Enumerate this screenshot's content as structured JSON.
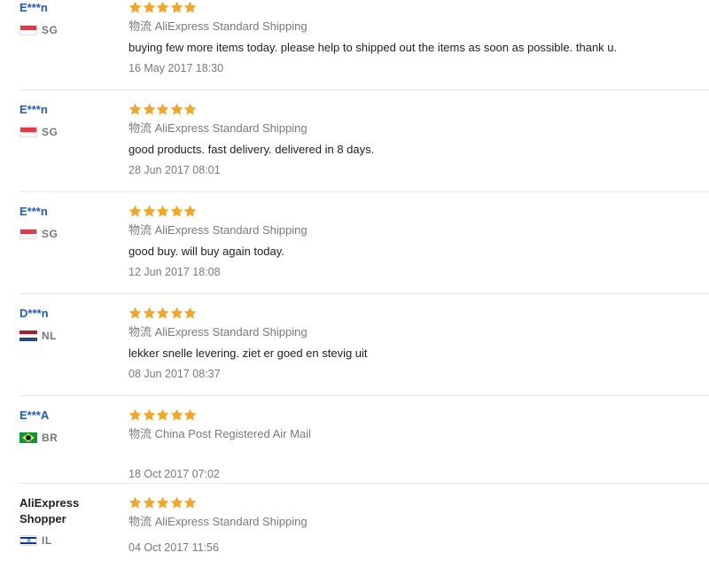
{
  "colors": {
    "star": "#f5a623",
    "buyer_link": "#1a5dc8",
    "meta_text": "#7a7a7a",
    "divider": "#e8e8e8"
  },
  "reviews": [
    {
      "buyer": "E***n",
      "country": "SG",
      "flag_icon": "singapore-flag-icon",
      "rating": 5,
      "shipping": "物流 AliExpress Standard Shipping",
      "feedback": "buying few more items today. please help to shipped out the items as soon as possible. thank u.",
      "date": "16 May 2017 18:30"
    },
    {
      "buyer": "E***n",
      "country": "SG",
      "flag_icon": "singapore-flag-icon",
      "rating": 5,
      "shipping": "物流 AliExpress Standard Shipping",
      "feedback": "good products. fast delivery. delivered in 8 days.",
      "date": "28 Jun 2017 08:01"
    },
    {
      "buyer": "E***n",
      "country": "SG",
      "flag_icon": "singapore-flag-icon",
      "rating": 5,
      "shipping": "物流 AliExpress Standard Shipping",
      "feedback": "good buy. will buy again today.",
      "date": "12 Jun 2017 18:08"
    },
    {
      "buyer": "D***n",
      "country": "NL",
      "flag_icon": "netherlands-flag-icon",
      "rating": 5,
      "shipping": "物流 AliExpress Standard Shipping",
      "feedback": "lekker snelle levering. ziet er goed en stevig uit",
      "date": "08 Jun 2017 08:37"
    },
    {
      "buyer": "E***A",
      "country": "BR",
      "flag_icon": "brazil-flag-icon",
      "rating": 5,
      "shipping": "物流 China Post Registered Air Mail",
      "feedback": "",
      "date": "18 Oct 2017 07:02"
    },
    {
      "buyer": "AliExpress Shopper",
      "country": "IL",
      "flag_icon": "israel-flag-icon",
      "rating": 5,
      "shipping": "物流 AliExpress Standard Shipping",
      "feedback": "",
      "date": "04 Oct 2017 11:56"
    }
  ]
}
